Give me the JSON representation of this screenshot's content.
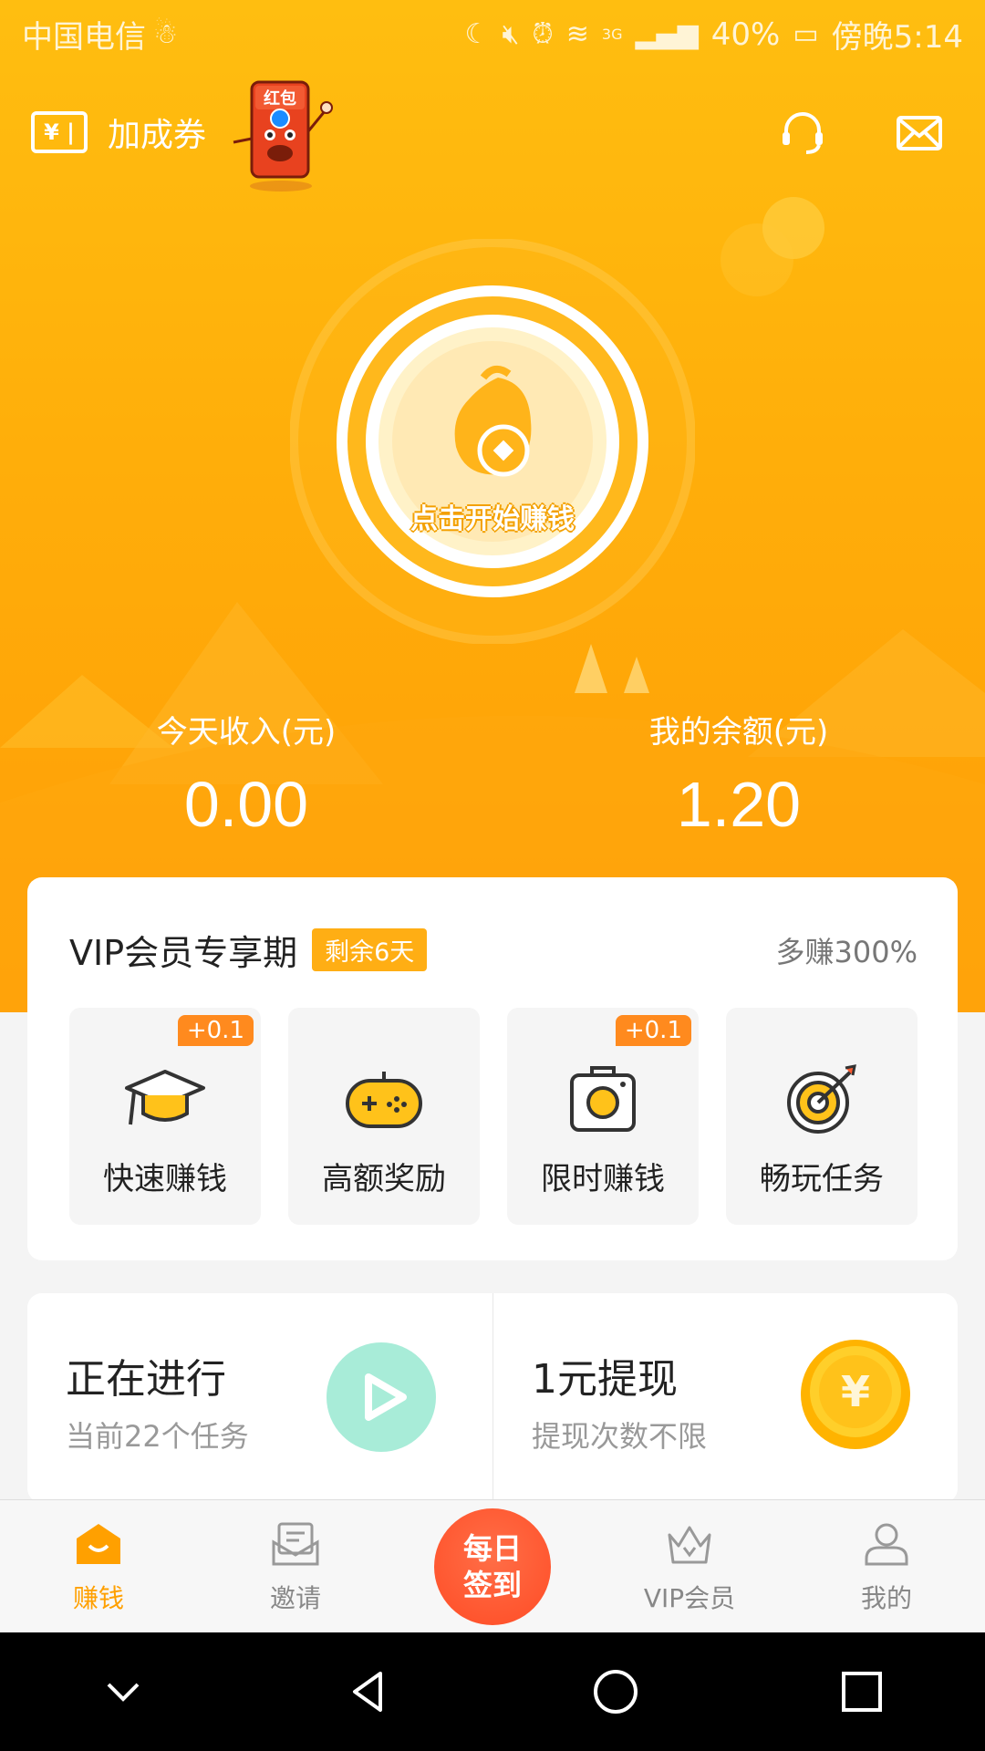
{
  "status_bar": {
    "carrier": "中国电信",
    "network": "3G",
    "battery": "40%",
    "time": "傍晚5:14"
  },
  "header": {
    "coupon_label": "加成券",
    "mascot_text": "红包"
  },
  "start_button": {
    "label": "点击开始赚钱"
  },
  "stats": {
    "today_label": "今天收入(元)",
    "today_value": "0.00",
    "balance_label": "我的余额(元)",
    "balance_value": "1.20"
  },
  "vip": {
    "title": "VIP会员专享期",
    "badge": "剩余6天",
    "more": "多赚300%",
    "tiles": [
      {
        "label": "快速赚钱",
        "bonus": "+0.1",
        "icon": "graduation-cap-icon"
      },
      {
        "label": "高额奖励",
        "bonus": "",
        "icon": "gamepad-icon"
      },
      {
        "label": "限时赚钱",
        "bonus": "+0.1",
        "icon": "camera-icon"
      },
      {
        "label": "畅玩任务",
        "bonus": "",
        "icon": "target-icon"
      }
    ]
  },
  "tasks": {
    "ongoing_title": "正在进行",
    "ongoing_sub": "当前22个任务",
    "withdraw_title": "1元提现",
    "withdraw_sub": "提现次数不限",
    "coin_symbol": "¥"
  },
  "tabbar": {
    "earn": "赚钱",
    "invite": "邀请",
    "signin_line1": "每日",
    "signin_line2": "签到",
    "vip": "VIP会员",
    "mine": "我的"
  },
  "colors": {
    "accent": "#ffa000",
    "hero_top": "#ffbe10",
    "hero_bottom": "#ff9d06",
    "signin": "#ff5a30",
    "play": "#a8ecd8"
  }
}
